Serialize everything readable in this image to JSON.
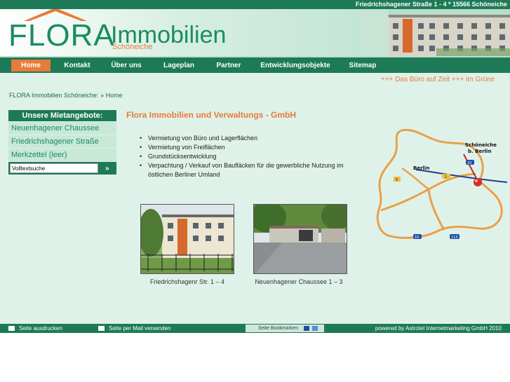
{
  "topbar": {
    "address": "Friedrichshagener Straße 1 - 4   *   15566 Schöneiche"
  },
  "logo": {
    "flora": "FLORA",
    "immobilien": "Immobilien",
    "sub": "Schöneiche"
  },
  "nav": {
    "items": [
      {
        "label": "Home"
      },
      {
        "label": "Kontakt"
      },
      {
        "label": "Über uns"
      },
      {
        "label": "Lageplan"
      },
      {
        "label": "Partner"
      },
      {
        "label": "Entwicklungsobjekte"
      },
      {
        "label": "Sitemap"
      }
    ]
  },
  "ticker": "+++ Das Büro auf Zeit +++ im Grüne",
  "breadcrumb": {
    "site": "FLORA Immobilien Schöneiche:",
    "sep": "»",
    "current": "Home"
  },
  "sidebar": {
    "heading": "Unsere Mietangebote:",
    "links": [
      {
        "label": "Neuenhagener Chaussee"
      },
      {
        "label": "Friedrichshagener Straße"
      },
      {
        "label": "Merkzettel (leer)"
      }
    ],
    "search": {
      "value": "Volltextsuche",
      "button": "»"
    }
  },
  "main": {
    "title": "Flora Immobilien und Verwaltungs - GmbH",
    "services": [
      "Vermietung von Büro und Lagerflächen",
      "Vermietung von Freiflächen",
      "Grundstücksentwicklung",
      "Verpachtung / Verkauf von Baufläcken für die gewerbliche Nutzung im östlichen Berliner Umland"
    ],
    "photos": [
      {
        "caption": "Friedrichshagenr Str. 1 – 4"
      },
      {
        "caption": "Neuenhagener Chaussee 1 – 3"
      }
    ]
  },
  "map": {
    "label_schoeneiche": "Schöneiche",
    "label_bberlin": "b. Berlin",
    "label_berlin": "Berlin",
    "badges": [
      "10",
      "1",
      "5",
      "10",
      "113"
    ]
  },
  "footer": {
    "print": "Seite ausdrucken",
    "mail": "Seite per Mail versenden",
    "bookmark": "Seite Bookmarken",
    "powered": "powered by Astrotel Internetmarketing GmbH 2010"
  },
  "colors": {
    "green": "#1d7a56",
    "orange": "#e87b3a",
    "light": "#dff2e9"
  }
}
